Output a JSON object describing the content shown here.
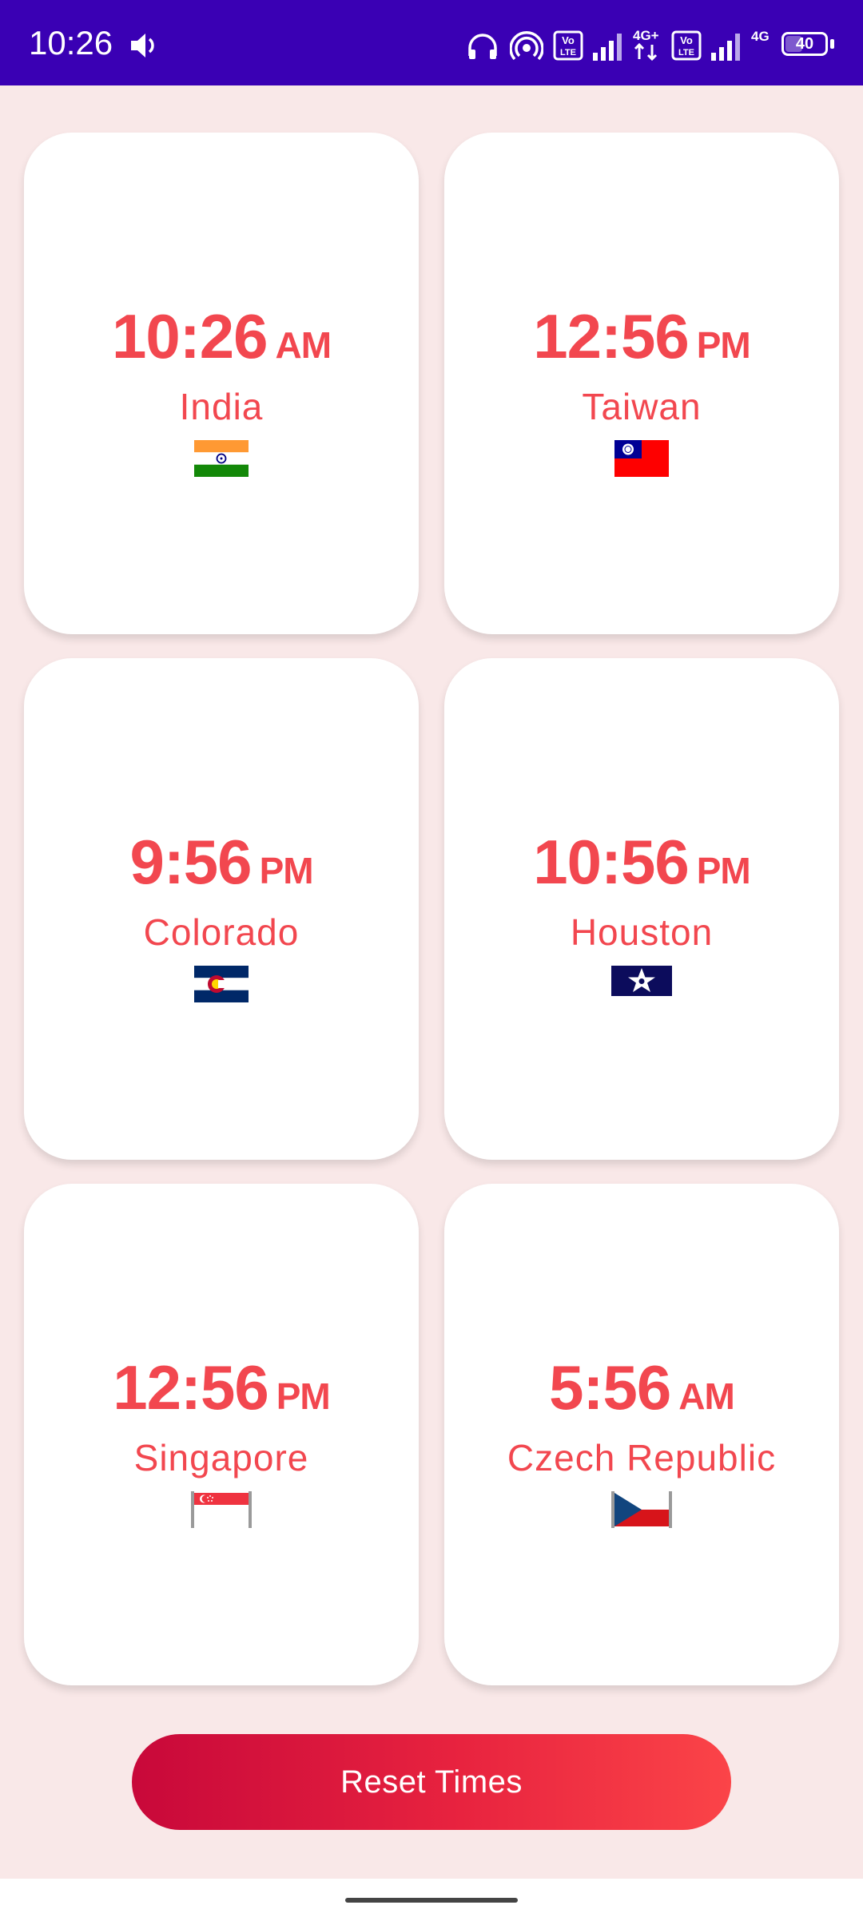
{
  "status_bar": {
    "time": "10:26",
    "battery": "40",
    "icons": [
      "volume-icon",
      "headphones-icon",
      "hotspot-icon",
      "volte-icon",
      "signal-icon",
      "4g-plus-icon",
      "volte-icon",
      "signal-icon",
      "4g-icon",
      "battery-icon"
    ]
  },
  "cards": [
    {
      "time": "10:26",
      "ampm": "AM",
      "place": "India",
      "flag": "india-flag"
    },
    {
      "time": "12:56",
      "ampm": "PM",
      "place": "Taiwan",
      "flag": "taiwan-flag"
    },
    {
      "time": "9:56",
      "ampm": "PM",
      "place": "Colorado",
      "flag": "colorado-flag"
    },
    {
      "time": "10:56",
      "ampm": "PM",
      "place": "Houston",
      "flag": "houston-flag"
    },
    {
      "time": "12:56",
      "ampm": "PM",
      "place": "Singapore",
      "flag": "singapore-flag"
    },
    {
      "time": "5:56",
      "ampm": "AM",
      "place": "Czech Republic",
      "flag": "czech-republic-flag"
    }
  ],
  "reset_button": {
    "label": "Reset Times"
  },
  "colors": {
    "accent": "#f2474f",
    "status_bar": "#3a00b4",
    "background": "#f9e8e8"
  }
}
